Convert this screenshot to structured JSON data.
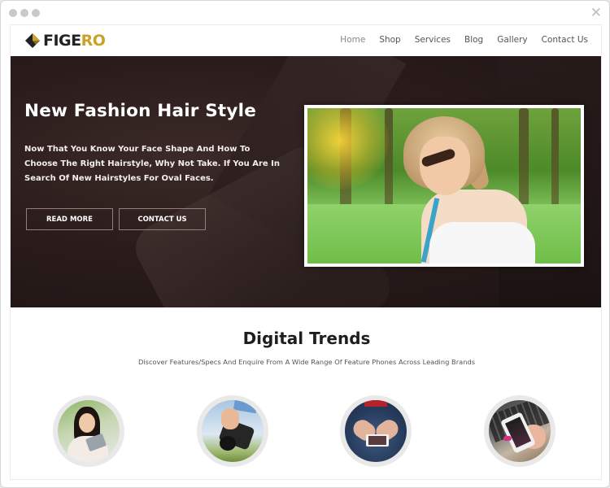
{
  "window": {
    "close_label": "✕"
  },
  "brand": {
    "logo_part1": "FIGE",
    "logo_part2": "RO",
    "accent_color": "#c9a227"
  },
  "nav": {
    "items": [
      {
        "label": "Home",
        "active": true
      },
      {
        "label": "Shop"
      },
      {
        "label": "Services"
      },
      {
        "label": "Blog"
      },
      {
        "label": "Gallery"
      },
      {
        "label": "Contact Us"
      }
    ]
  },
  "hero": {
    "title": "New Fashion Hair Style",
    "description": "Now That You Know Your Face Shape And How To Choose The Right Hairstyle, Why Not Take. If You Are In Search Of New Hairstyles For Oval Faces.",
    "buttons": {
      "read_more": "READ MORE",
      "contact_us": "CONTACT US"
    },
    "image_alt": "woman-with-sunglasses-in-park"
  },
  "section": {
    "title": "Digital Trends",
    "subtitle": "Discover Features/Specs And Enquire From A Wide Range Of Feature Phones Across Leading Brands",
    "features": [
      {
        "image": "girl-with-tablet"
      },
      {
        "image": "hand-with-camera"
      },
      {
        "image": "hands-holding-phone"
      },
      {
        "image": "phone-over-keyboard"
      }
    ]
  }
}
